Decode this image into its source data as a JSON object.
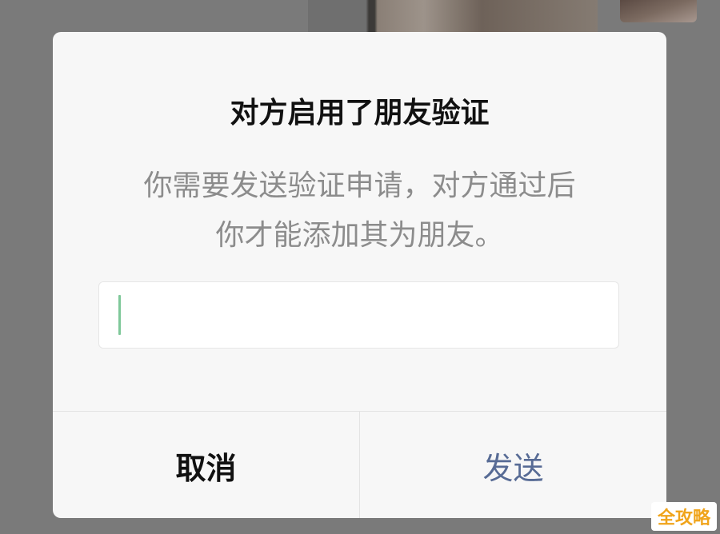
{
  "dialog": {
    "title": "对方启用了朋友验证",
    "message_line1": "你需要发送验证申请，对方通过后",
    "message_line2": "你才能添加其为朋友。",
    "input": {
      "value": "",
      "placeholder": ""
    },
    "cancel_label": "取消",
    "send_label": "发送"
  },
  "watermark": {
    "text": "全攻略"
  },
  "colors": {
    "send_accent": "#576b95",
    "caret": "#7fc89a",
    "overlay": "#7a7a7a",
    "dialog_bg": "#f7f7f7"
  }
}
